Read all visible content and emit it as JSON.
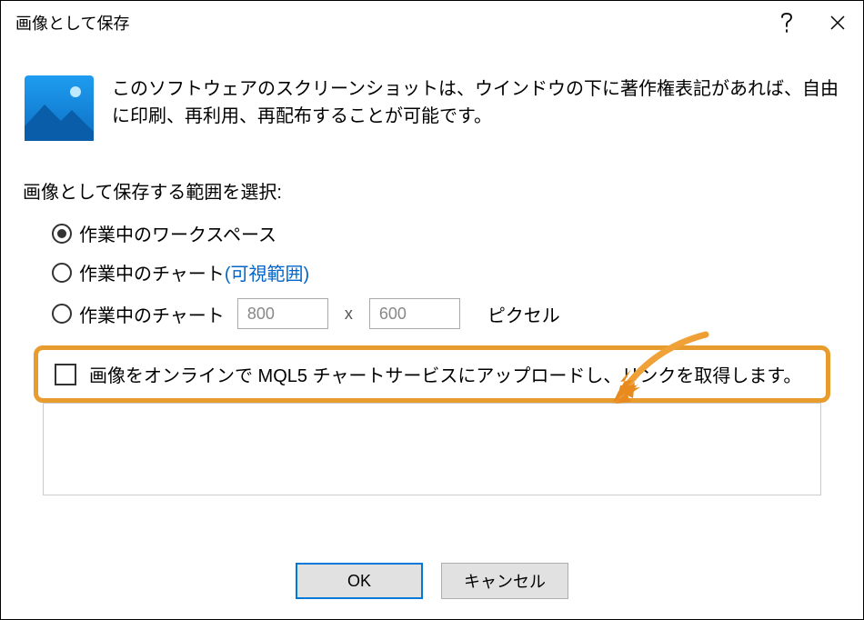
{
  "titlebar": {
    "title": "画像として保存"
  },
  "info": {
    "text": "このソフトウェアのスクリーンショットは、ウインドウの下に著作権表記があれば、自由に印刷、再利用、再配布することが可能です。"
  },
  "section": {
    "label": "画像として保存する範囲を選択:"
  },
  "radios": {
    "workspace": "作業中のワークスペース",
    "chart_visible_prefix": "作業中のチャート",
    "chart_visible_paren": "(可視範囲)",
    "chart_custom": "作業中のチャート",
    "width": "800",
    "height": "600",
    "x": "x",
    "pixel": "ピクセル"
  },
  "upload": {
    "label": "画像をオンラインで MQL5 チャートサービスにアップロードし、リンクを取得します。"
  },
  "buttons": {
    "ok": "OK",
    "cancel": "キャンセル"
  }
}
